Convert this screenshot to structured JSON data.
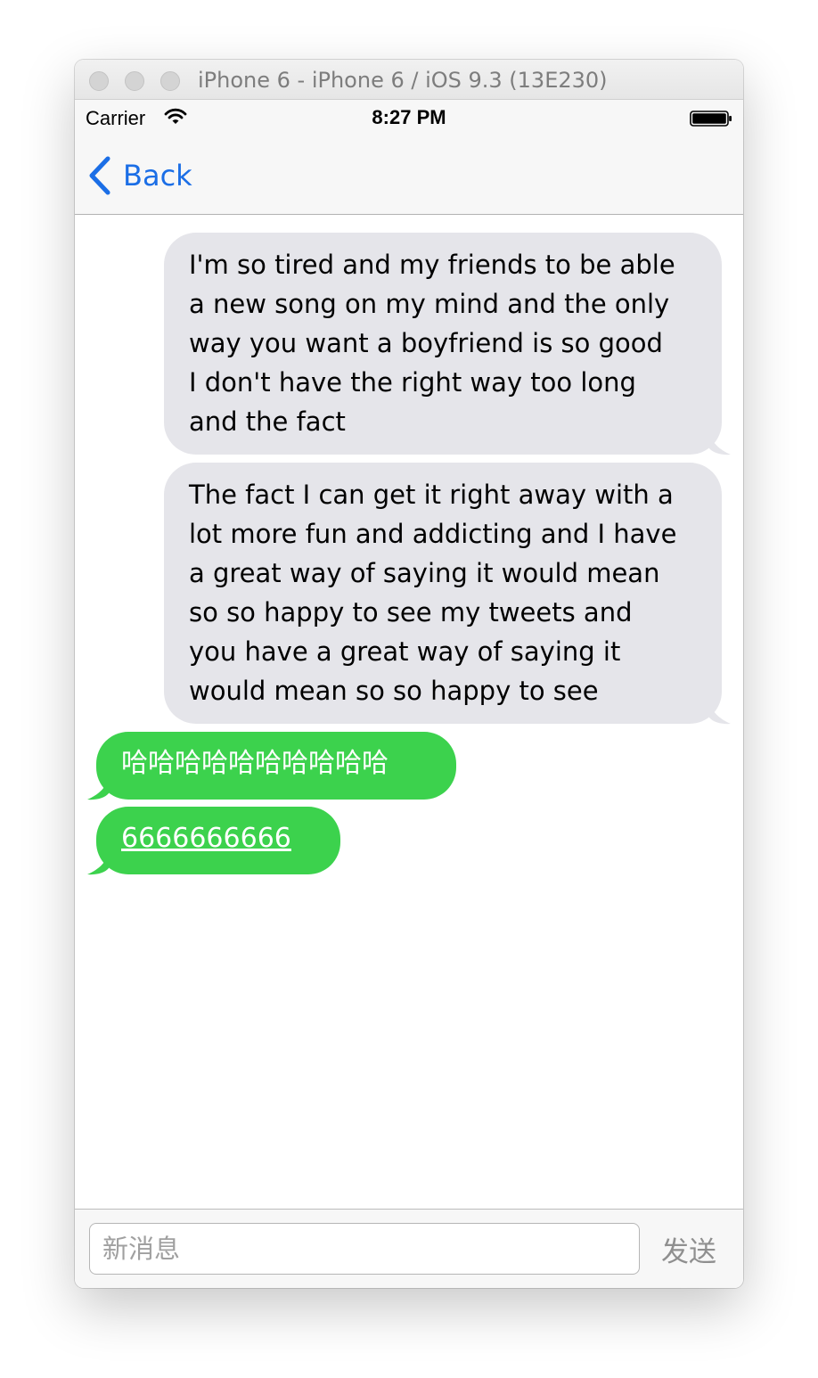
{
  "window": {
    "title": "iPhone 6 - iPhone 6 / iOS 9.3 (13E230)"
  },
  "status_bar": {
    "carrier": "Carrier",
    "time": "8:27 PM",
    "icons": [
      "wifi-icon",
      "battery-icon"
    ]
  },
  "nav": {
    "back_label": "Back",
    "back_icon": "chevron-left-icon"
  },
  "messages": [
    {
      "direction": "incoming",
      "text": "I'm so tired and my friends to be able\na new song on my mind and the only\nway you want a boyfriend is so good\nI don't have the right way too long\nand the fact"
    },
    {
      "direction": "incoming",
      "text": "The fact I can get it right away with a\nlot more fun and addicting and I have\na great way of saying it would mean\nso so happy to see my tweets and\nyou have a great way of saying it\nwould mean so so happy to see"
    },
    {
      "direction": "outgoing",
      "text": "哈哈哈哈哈哈哈哈哈哈"
    },
    {
      "direction": "outgoing",
      "text": "6666666666",
      "is_link": true
    }
  ],
  "composer": {
    "placeholder": "新消息",
    "value": "",
    "send_label": "发送"
  },
  "colors": {
    "incoming_bubble": "#e5e5ea",
    "outgoing_bubble": "#3cd24d",
    "accent": "#1b6ee6",
    "send_disabled": "#8f8f8f"
  }
}
